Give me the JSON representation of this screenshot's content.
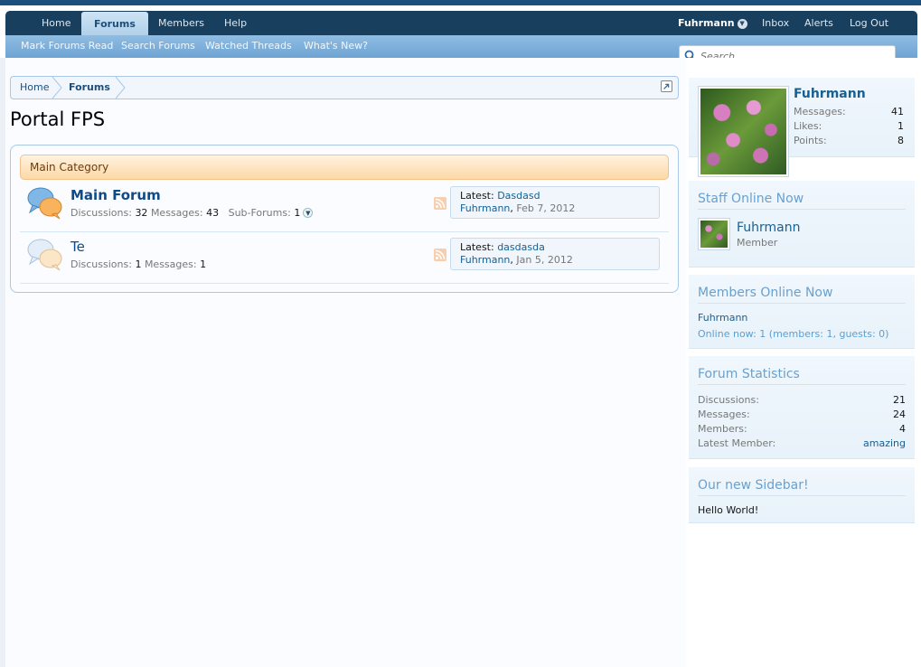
{
  "nav": {
    "tabs": [
      {
        "label": "Home"
      },
      {
        "label": "Forums"
      },
      {
        "label": "Members"
      },
      {
        "label": "Help"
      }
    ],
    "user": "Fuhrmann",
    "right_links": [
      {
        "label": "Inbox"
      },
      {
        "label": "Alerts"
      },
      {
        "label": "Log Out"
      }
    ],
    "sub_links": [
      {
        "label": "Mark Forums Read"
      },
      {
        "label": "Search Forums"
      },
      {
        "label": "Watched Threads"
      },
      {
        "label": "What's New?"
      }
    ]
  },
  "search": {
    "placeholder": "Search..."
  },
  "breadcrumb": [
    {
      "label": "Home"
    },
    {
      "label": "Forums"
    }
  ],
  "page_title": "Portal FPS",
  "category": {
    "title": "Main Category"
  },
  "forums": [
    {
      "title": "Main Forum",
      "discussions_label": "Discussions:",
      "discussions": "32",
      "messages_label": "Messages:",
      "messages": "43",
      "subforums_label": "Sub-Forums:",
      "subforums": "1",
      "latest_label": "Latest:",
      "latest_thread": "Dasdasd",
      "latest_user": "Fuhrmann",
      "latest_date": "Feb 7, 2012"
    },
    {
      "title": "Te",
      "discussions_label": "Discussions:",
      "discussions": "1",
      "messages_label": "Messages:",
      "messages": "1",
      "latest_label": "Latest:",
      "latest_thread": "dasdasda",
      "latest_user": "Fuhrmann",
      "latest_date": "Jan 5, 2012"
    }
  ],
  "sidebar": {
    "visitor": {
      "name": "Fuhrmann",
      "stats": [
        {
          "label": "Messages:",
          "value": "41"
        },
        {
          "label": "Likes:",
          "value": "1"
        },
        {
          "label": "Points:",
          "value": "8"
        }
      ]
    },
    "staff_online": {
      "heading": "Staff Online Now",
      "name": "Fuhrmann",
      "role": "Member"
    },
    "members_online": {
      "heading": "Members Online Now",
      "member": "Fuhrmann",
      "summary": "Online now: 1 (members: 1, guests: 0)"
    },
    "forum_stats": {
      "heading": "Forum Statistics",
      "rows": [
        {
          "label": "Discussions:",
          "value": "21"
        },
        {
          "label": "Messages:",
          "value": "24"
        },
        {
          "label": "Members:",
          "value": "4"
        },
        {
          "label": "Latest Member:",
          "value": "amazing"
        }
      ]
    },
    "custom": {
      "heading": "Our new Sidebar!",
      "text": "Hello World!"
    }
  },
  "colors": {
    "nav_dark": "#193f5f",
    "nav_selected": "#cfe3f4",
    "subbar": "#7fb1dc",
    "link": "#176093",
    "category_bg": "#fcd9a6",
    "sidebar_heading": "#6aa0cd"
  }
}
